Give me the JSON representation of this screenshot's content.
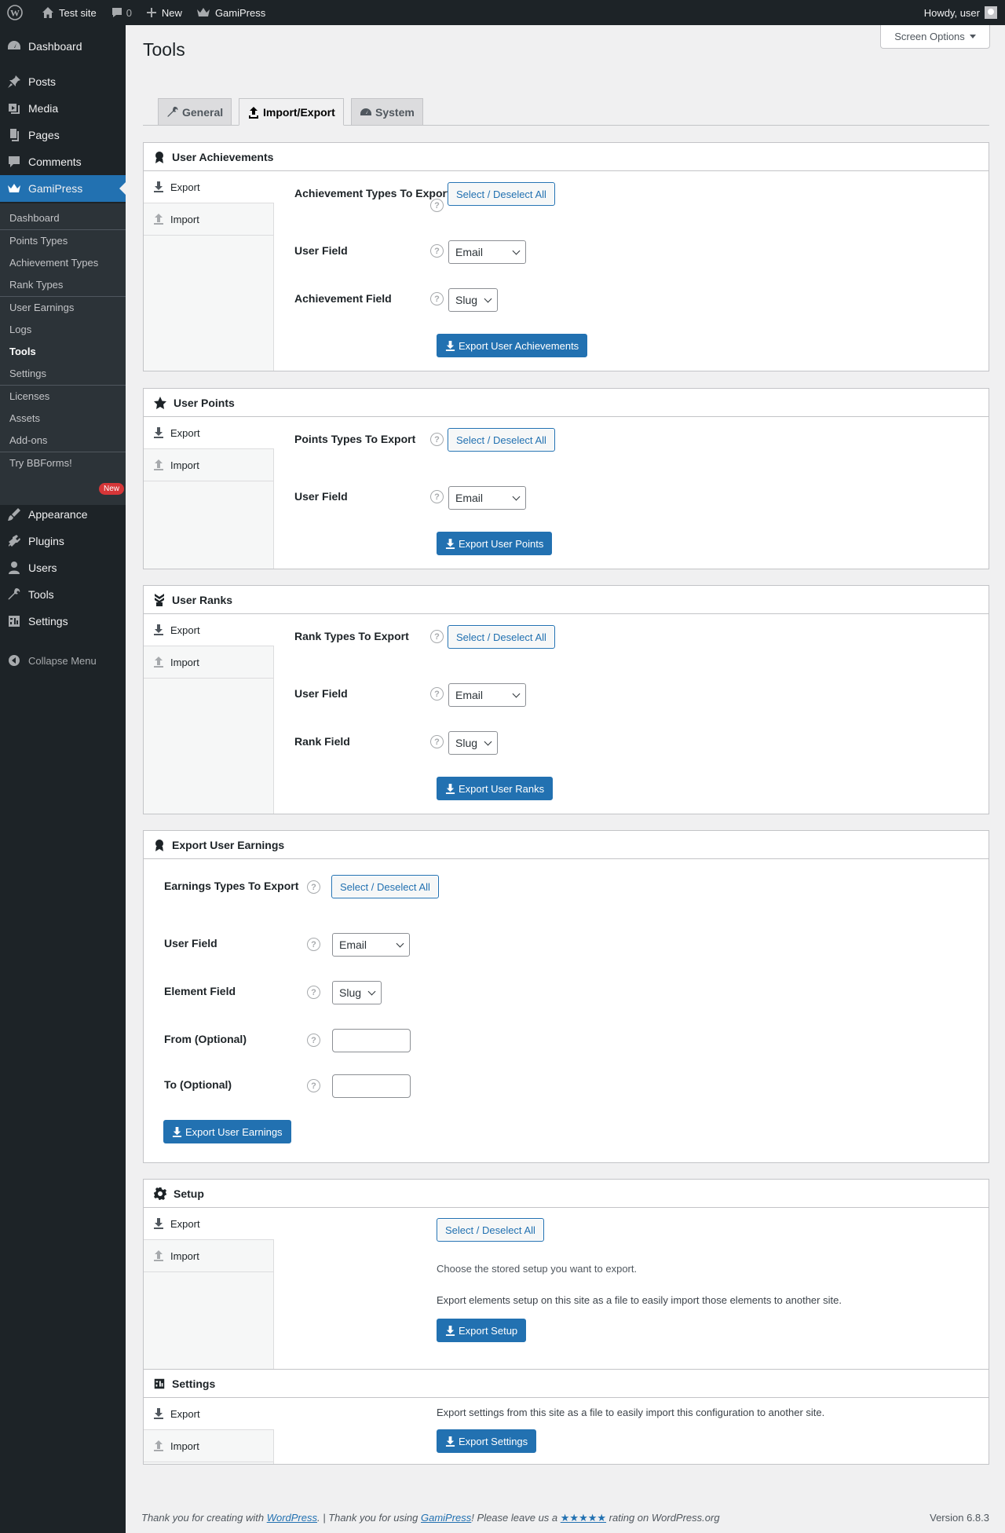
{
  "adminbar": {
    "site_name": "Test site",
    "comments_count": "0",
    "new_label": "New",
    "plugin_label": "GamiPress",
    "howdy": "Howdy, user"
  },
  "sidebar": {
    "menu": [
      {
        "label": "Dashboard",
        "icon": "dashboard-icon"
      },
      {
        "label": "Posts",
        "icon": "pin-icon"
      },
      {
        "label": "Media",
        "icon": "media-icon"
      },
      {
        "label": "Pages",
        "icon": "pages-icon"
      },
      {
        "label": "Comments",
        "icon": "comments-icon"
      },
      {
        "label": "GamiPress",
        "icon": "crown-icon"
      }
    ],
    "submenu": [
      "Dashboard",
      "Points Types",
      "Achievement Types",
      "Rank Types",
      "User Earnings",
      "Logs",
      "Tools",
      "Settings",
      "Licenses",
      "Assets",
      "Add-ons",
      "Try BBForms!"
    ],
    "new_badge": "New",
    "menu_bottom": [
      {
        "label": "Appearance",
        "icon": "appearance-icon"
      },
      {
        "label": "Plugins",
        "icon": "plugins-icon"
      },
      {
        "label": "Users",
        "icon": "users-icon"
      },
      {
        "label": "Tools",
        "icon": "tools-icon"
      },
      {
        "label": "Settings",
        "icon": "settings-icon"
      }
    ],
    "collapse": "Collapse Menu"
  },
  "page": {
    "title": "Tools",
    "screen_options": "Screen Options",
    "tabs": [
      "General",
      "Import/Export",
      "System"
    ]
  },
  "common": {
    "export": "Export",
    "import": "Import",
    "select_all": "Select / Deselect All",
    "help": "?"
  },
  "user_achievements": {
    "title": "User Achievements",
    "types_label": "Achievement Types To Export",
    "user_field_label": "User Field",
    "user_field_value": "Email",
    "element_field_label": "Achievement Field",
    "element_field_value": "Slug",
    "button": "Export User Achievements"
  },
  "user_points": {
    "title": "User Points",
    "types_label": "Points Types To Export",
    "user_field_label": "User Field",
    "user_field_value": "Email",
    "button": "Export User Points"
  },
  "user_ranks": {
    "title": "User Ranks",
    "types_label": "Rank Types To Export",
    "user_field_label": "User Field",
    "user_field_value": "Email",
    "element_field_label": "Rank Field",
    "element_field_value": "Slug",
    "button": "Export User Ranks"
  },
  "user_earnings": {
    "title": "Export User Earnings",
    "types_label": "Earnings Types To Export",
    "user_field_label": "User Field",
    "user_field_value": "Email",
    "element_field_label": "Element Field",
    "element_field_value": "Slug",
    "from_label": "From (Optional)",
    "from_value": "",
    "to_label": "To (Optional)",
    "to_value": "",
    "button": "Export User Earnings"
  },
  "setup": {
    "title": "Setup",
    "desc1": "Choose the stored setup you want to export.",
    "desc2": "Export elements setup on this site as a file to easily import those elements to another site.",
    "button": "Export Setup"
  },
  "settings_box": {
    "title": "Settings",
    "desc": "Export settings from this site as a file to easily import this configuration to another site.",
    "button": "Export Settings"
  },
  "footer": {
    "text1": "Thank you for creating with ",
    "link1": "WordPress",
    "text2": ". | Thank you for using ",
    "link2": "GamiPress",
    "text3": "! Please leave us a ",
    "stars": "★★★★★",
    "text4": " rating on WordPress.org",
    "version": "Version 6.8.3"
  },
  "colors": {
    "accent": "#2271b1",
    "sidebar_bg": "#1d2327",
    "submenu_bg": "#2c3338",
    "badge": "#d63638"
  }
}
